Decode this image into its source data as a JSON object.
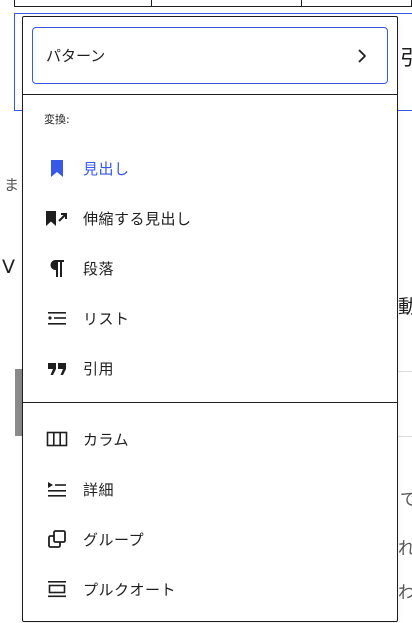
{
  "colors": {
    "accent": "#3858e9",
    "text": "#1e1e1e"
  },
  "background": {
    "glyphs": [
      "引",
      "ま",
      "V",
      "動",
      "で",
      "れ",
      "わ"
    ]
  },
  "pattern_button": {
    "label": "パターン",
    "icon": "chevron-right-icon"
  },
  "transform_section": {
    "title": "変換:",
    "items": [
      {
        "label": "見出し",
        "icon": "bookmark-icon",
        "active": true
      },
      {
        "label": "伸縮する見出し",
        "icon": "stretchy-heading-icon"
      },
      {
        "label": "段落",
        "icon": "paragraph-icon"
      },
      {
        "label": "リスト",
        "icon": "list-icon"
      },
      {
        "label": "引用",
        "icon": "quote-icon"
      }
    ]
  },
  "group_section": {
    "items": [
      {
        "label": "カラム",
        "icon": "columns-icon"
      },
      {
        "label": "詳細",
        "icon": "details-icon"
      },
      {
        "label": "グループ",
        "icon": "group-icon"
      },
      {
        "label": "プルクオート",
        "icon": "pullquote-icon"
      }
    ]
  }
}
